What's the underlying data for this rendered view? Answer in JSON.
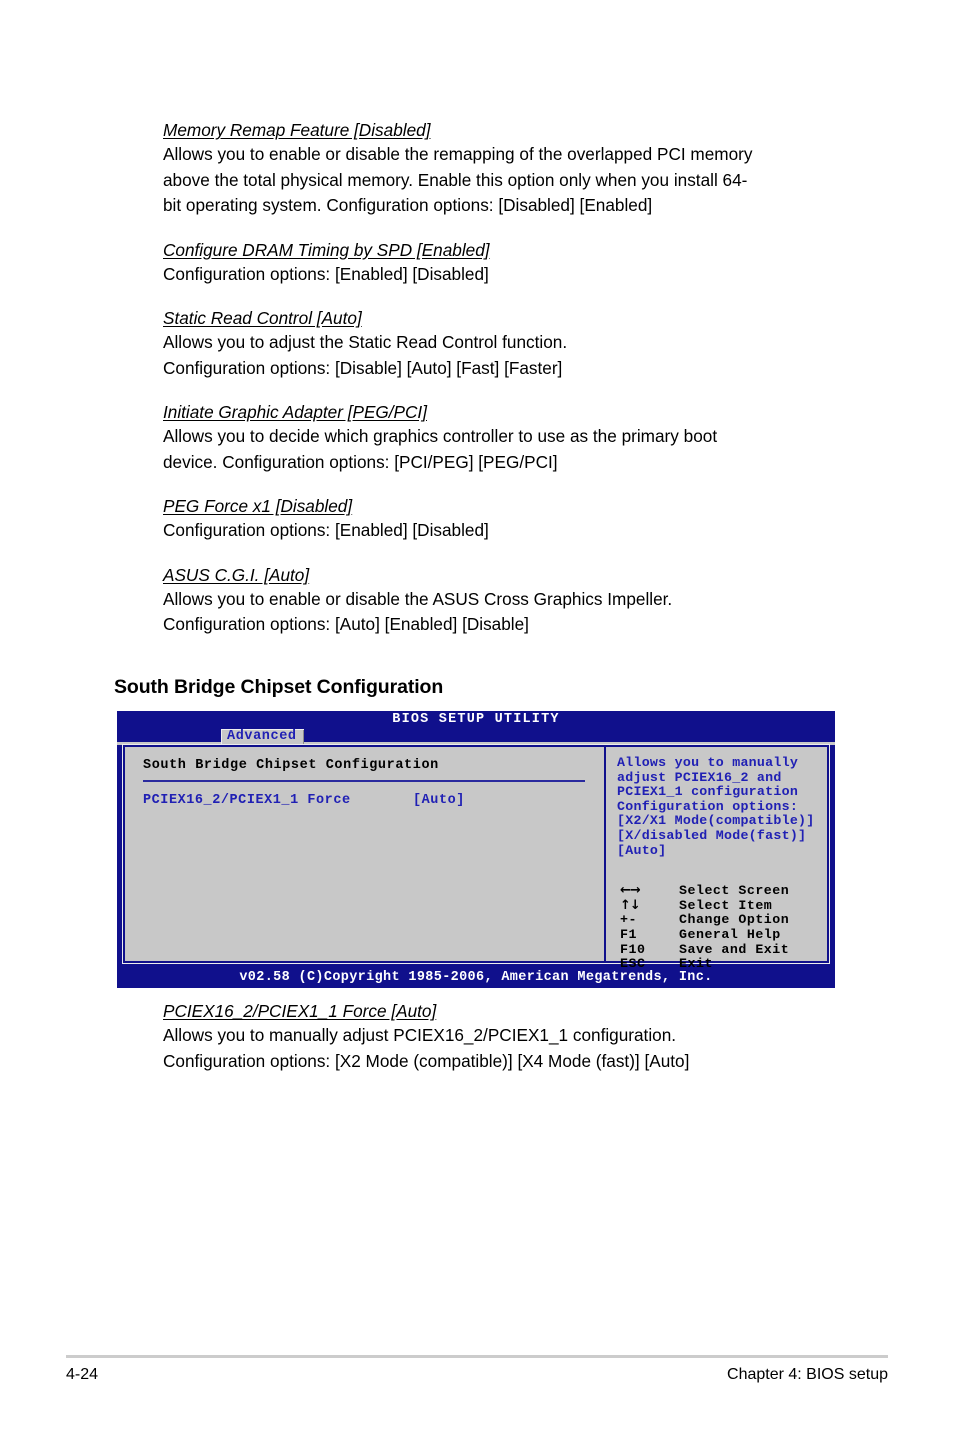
{
  "document": {
    "entries": [
      {
        "title": "Memory Remap Feature [Disabled]",
        "lines": [
          "Allows you to enable or disable the remapping of the overlapped PCI memory",
          "above the total physical memory. Enable this option only when you install 64-",
          "bit operating system. Configuration options: [Disabled] [Enabled]"
        ]
      },
      {
        "title": "Configure DRAM Timing by SPD [Enabled]",
        "lines": [
          "Configuration options: [Enabled] [Disabled]"
        ]
      },
      {
        "title": "Static Read Control [Auto]",
        "lines": [
          "Allows you to adjust the Static Read Control function.",
          "Configuration options: [Disable] [Auto] [Fast] [Faster]"
        ]
      },
      {
        "title": "Initiate Graphic Adapter [PEG/PCI]",
        "lines": [
          "Allows you to decide which graphics controller to use as the primary boot",
          "device. Configuration options: [PCI/PEG] [PEG/PCI]"
        ]
      },
      {
        "title": "PEG Force x1 [Disabled]",
        "lines": [
          "Configuration options: [Enabled] [Disabled]"
        ]
      },
      {
        "title": "ASUS C.G.I. [Auto]",
        "lines": [
          "Allows you to enable or disable the ASUS Cross Graphics Impeller.",
          "Configuration options: [Auto] [Enabled] [Disable]"
        ]
      }
    ],
    "section_heading": "South Bridge Chipset Configuration",
    "entries_after": [
      {
        "title": "PCIEX16_2/PCIEX1_1 Force [Auto]",
        "lines": [
          "Allows you to manually adjust PCIEX16_2/PCIEX1_1 configuration.",
          "Configuration options: [X2 Mode (compatible)] [X4 Mode (fast)] [Auto]"
        ]
      }
    ]
  },
  "bios": {
    "title": "BIOS SETUP UTILITY",
    "active_tab": "Advanced",
    "panel_title": "South Bridge Chipset Configuration",
    "settings": [
      {
        "label": "PCIEX16_2/PCIEX1_1 Force",
        "value": "[Auto]"
      }
    ],
    "help": {
      "lines": [
        "Allows you to manually",
        "adjust PCIEX16_2 and",
        "PCIEX1_1 configuration",
        "Configuration options:",
        "[X2/X1 Mode(compatible)]",
        "[X/disabled Mode(fast)]",
        "[Auto]"
      ]
    },
    "key_legend": [
      {
        "key": "←→",
        "desc": "Select Screen",
        "arrows": true
      },
      {
        "key": "↑↓",
        "desc": "Select Item",
        "arrows": true
      },
      {
        "key": "+-",
        "desc": "Change Option",
        "arrows": false
      },
      {
        "key": "F1",
        "desc": "General Help",
        "arrows": false
      },
      {
        "key": "F10",
        "desc": "Save and Exit",
        "arrows": false
      },
      {
        "key": "ESC",
        "desc": "Exit",
        "arrows": false
      }
    ],
    "footer": "v02.58 (C)Copyright 1985-2006, American Megatrends, Inc.",
    "colors": {
      "chrome": "#10108c",
      "panel": "#c8c8c8",
      "accent_text": "#2020b4"
    }
  },
  "page_footer": {
    "page_number": "4-24",
    "chapter": "Chapter 4: BIOS setup"
  }
}
